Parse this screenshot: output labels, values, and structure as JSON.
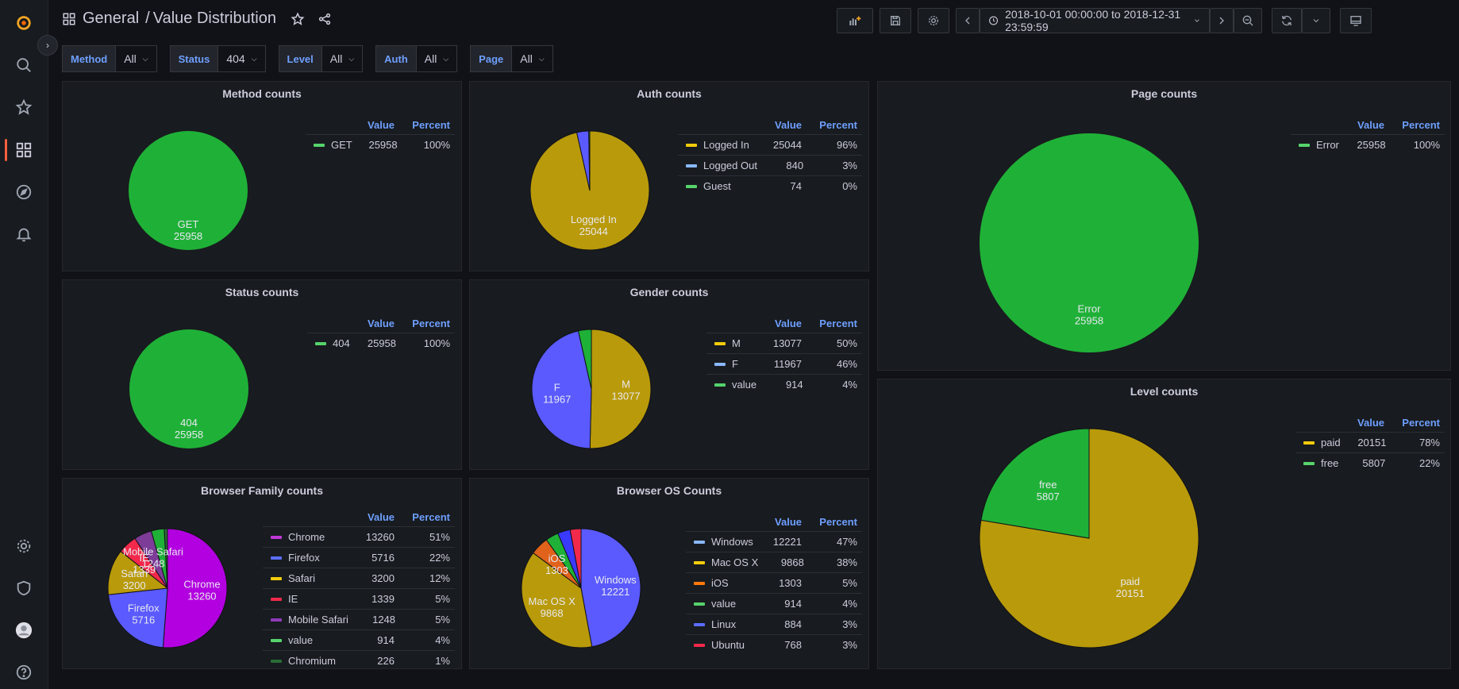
{
  "breadcrumb": {
    "folder": "General",
    "separator": "/",
    "title": "Value Distribution"
  },
  "toolbar": {
    "time_range": "2018-10-01 00:00:00 to 2018-12-31 23:59:59"
  },
  "variables": [
    {
      "label": "Method",
      "value": "All"
    },
    {
      "label": "Status",
      "value": "404"
    },
    {
      "label": "Level",
      "value": "All"
    },
    {
      "label": "Auth",
      "value": "All"
    },
    {
      "label": "Page",
      "value": "All"
    }
  ],
  "legend_headers": {
    "value": "Value",
    "percent": "Percent"
  },
  "colors": {
    "green": "#1fb137",
    "gold": "#b99a0a",
    "blue": "#5a5aff",
    "lightblue": "#8ab8ff",
    "yellow": "#f2cc0c",
    "purple": "#b300e0",
    "red": "#f2294b",
    "violet": "#7c3c97",
    "orange": "#e0621b",
    "magenta": "#c138d8",
    "accent": "#f55f3e",
    "link": "#6e9fff"
  },
  "chart_data": [
    {
      "type": "pie",
      "title": "Method counts",
      "slices": [
        {
          "name": "GET",
          "value": 25958,
          "percent": "100%",
          "color": "#1fb137",
          "swatch": "#56d36c",
          "label": true
        }
      ]
    },
    {
      "type": "pie",
      "title": "Auth counts",
      "slices": [
        {
          "name": "Logged In",
          "value": 25044,
          "percent": "96%",
          "color": "#b99a0a",
          "swatch": "#f2cc0c",
          "label": true
        },
        {
          "name": "Logged Out",
          "value": 840,
          "percent": "3%",
          "color": "#5a5aff",
          "swatch": "#8ab8ff",
          "label": false
        },
        {
          "name": "Guest",
          "value": 74,
          "percent": "0%",
          "color": "#1fb137",
          "swatch": "#56d36c",
          "label": false
        }
      ]
    },
    {
      "type": "pie",
      "title": "Page counts",
      "slices": [
        {
          "name": "Error",
          "value": 25958,
          "percent": "100%",
          "color": "#1fb137",
          "swatch": "#56d36c",
          "label": true
        }
      ]
    },
    {
      "type": "pie",
      "title": "Status counts",
      "slices": [
        {
          "name": "404",
          "value": 25958,
          "percent": "100%",
          "color": "#1fb137",
          "swatch": "#56d36c",
          "label": true
        }
      ]
    },
    {
      "type": "pie",
      "title": "Gender counts",
      "slices": [
        {
          "name": "M",
          "value": 13077,
          "percent": "50%",
          "color": "#b99a0a",
          "swatch": "#f2cc0c",
          "label": true
        },
        {
          "name": "F",
          "value": 11967,
          "percent": "46%",
          "color": "#5a5aff",
          "swatch": "#8ab8ff",
          "label": true
        },
        {
          "name": "value",
          "value": 914,
          "percent": "4%",
          "color": "#1fb137",
          "swatch": "#56d36c",
          "label": false
        }
      ]
    },
    {
      "type": "pie",
      "title": "Level counts",
      "slices": [
        {
          "name": "paid",
          "value": 20151,
          "percent": "78%",
          "color": "#b99a0a",
          "swatch": "#f2cc0c",
          "label": true
        },
        {
          "name": "free",
          "value": 5807,
          "percent": "22%",
          "color": "#1fb137",
          "swatch": "#56d36c",
          "label": true
        }
      ]
    },
    {
      "type": "pie",
      "title": "Browser Family counts",
      "slices": [
        {
          "name": "Chrome",
          "value": 13260,
          "percent": "51%",
          "color": "#b300e0",
          "swatch": "#c138d8",
          "label": true
        },
        {
          "name": "Firefox",
          "value": 5716,
          "percent": "22%",
          "color": "#5a5aff",
          "swatch": "#5a6dff",
          "label": true
        },
        {
          "name": "Safari",
          "value": 3200,
          "percent": "12%",
          "color": "#b99a0a",
          "swatch": "#f2cc0c",
          "label": true
        },
        {
          "name": "IE",
          "value": 1339,
          "percent": "5%",
          "color": "#f2294b",
          "swatch": "#f2294b",
          "label": true
        },
        {
          "name": "Mobile Safari",
          "value": 1248,
          "percent": "5%",
          "color": "#7c3c97",
          "swatch": "#8f3bb8",
          "label": true
        },
        {
          "name": "value",
          "value": 914,
          "percent": "4%",
          "color": "#1fb137",
          "swatch": "#56d36c",
          "label": false
        },
        {
          "name": "Chromium",
          "value": 226,
          "percent": "1%",
          "color": "#2a6b36",
          "swatch": "#2a6b36",
          "label": false
        }
      ]
    },
    {
      "type": "pie",
      "title": "Browser OS Counts",
      "slices": [
        {
          "name": "Windows",
          "value": 12221,
          "percent": "47%",
          "color": "#5a5aff",
          "swatch": "#8ab8ff",
          "label": true
        },
        {
          "name": "Mac OS X",
          "value": 9868,
          "percent": "38%",
          "color": "#b99a0a",
          "swatch": "#f2cc0c",
          "label": true
        },
        {
          "name": "iOS",
          "value": 1303,
          "percent": "5%",
          "color": "#e0621b",
          "swatch": "#ff780a",
          "label": true
        },
        {
          "name": "value",
          "value": 914,
          "percent": "4%",
          "color": "#1fb137",
          "swatch": "#56d36c",
          "label": false
        },
        {
          "name": "Linux",
          "value": 884,
          "percent": "3%",
          "color": "#3a3aff",
          "swatch": "#5a6dff",
          "label": false
        },
        {
          "name": "Ubuntu",
          "value": 768,
          "percent": "3%",
          "color": "#f2294b",
          "swatch": "#f2294b",
          "label": false
        }
      ]
    }
  ]
}
